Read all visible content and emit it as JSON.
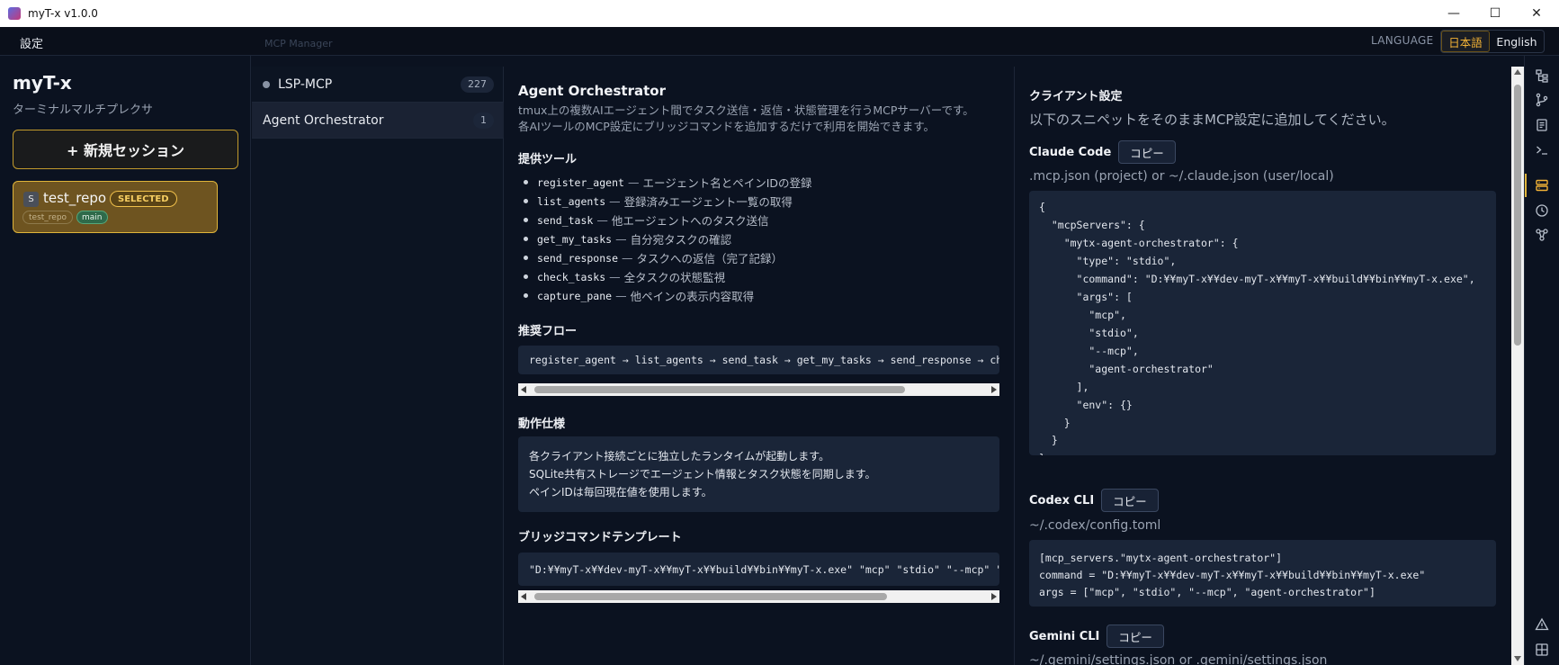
{
  "window": {
    "title": "myT-x v1.0.0",
    "controls": [
      "—",
      "☐",
      "✕"
    ]
  },
  "menubar": {
    "settings": "設定",
    "ghost_text": "MCP Manager",
    "language_label": "LANGUAGE",
    "lang_ja": "日本語",
    "lang_en": "English"
  },
  "sidebar": {
    "app_name": "myT-x",
    "subtitle": "ターミナルマルチプレクサ",
    "new_session": "+ 新規セッション",
    "session": {
      "badge": "S",
      "name": "test_repo",
      "status": "SELECTED",
      "repo_tag": "test_repo",
      "branch_tag": "main"
    }
  },
  "mcp_list": [
    {
      "label": "LSP-MCP",
      "count": "227"
    },
    {
      "label": "Agent Orchestrator",
      "count": "1"
    }
  ],
  "detail": {
    "title": "Agent Orchestrator",
    "desc_1": "tmux上の複数AIエージェント間でタスク送信・返信・状態管理を行うMCPサーバーです。",
    "desc_2": "各AIツールのMCP設定にブリッジコマンドを追加するだけで利用を開始できます。",
    "tools_heading": "提供ツール",
    "tools": [
      {
        "name": "register_agent",
        "sep": "—",
        "desc": "エージェント名とペインIDの登録"
      },
      {
        "name": "list_agents",
        "sep": "—",
        "desc": "登録済みエージェント一覧の取得"
      },
      {
        "name": "send_task",
        "sep": "—",
        "desc": "他エージェントへのタスク送信"
      },
      {
        "name": "get_my_tasks",
        "sep": "—",
        "desc": "自分宛タスクの確認"
      },
      {
        "name": "send_response",
        "sep": "—",
        "desc": "タスクへの返信（完了記録）"
      },
      {
        "name": "check_tasks",
        "sep": "—",
        "desc": "全タスクの状態監視"
      },
      {
        "name": "capture_pane",
        "sep": "—",
        "desc": "他ペインの表示内容取得"
      }
    ],
    "flow_heading": "推奨フロー",
    "flow": "register_agent → list_agents → send_task → get_my_tasks → send_response → check_tasks",
    "spec_heading": "動作仕様",
    "spec_lines": [
      "各クライアント接続ごとに独立したランタイムが起動します。",
      "SQLite共有ストレージでエージェント情報とタスク状態を同期します。",
      "ペインIDは毎回現在値を使用します。"
    ],
    "bridge_heading": "ブリッジコマンドテンプレート",
    "bridge": "\"D:¥¥myT-x¥¥dev-myT-x¥¥myT-x¥¥build¥¥bin¥¥myT-x.exe\" \"mcp\" \"stdio\" \"--mcp\" \"agent-orchestrator\""
  },
  "client": {
    "heading": "クライアント設定",
    "intro": "以下のスニペットをそのままMCP設定に追加してください。",
    "copy_label": "コピー",
    "claude": {
      "name": "Claude Code",
      "path": ".mcp.json (project) or ~/.claude.json (user/local)",
      "lines": [
        "{",
        "  \"mcpServers\": {",
        "    \"mytx-agent-orchestrator\": {",
        "      \"type\": \"stdio\",",
        "      \"command\": \"D:¥¥myT-x¥¥dev-myT-x¥¥myT-x¥¥build¥¥bin¥¥myT-x.exe\",",
        "      \"args\": [",
        "        \"mcp\",",
        "        \"stdio\",",
        "        \"--mcp\",",
        "        \"agent-orchestrator\"",
        "      ],",
        "      \"env\": {}",
        "    }",
        "  }",
        "}"
      ]
    },
    "codex": {
      "name": "Codex CLI",
      "path": "~/.codex/config.toml",
      "lines": [
        "[mcp_servers.\"mytx-agent-orchestrator\"]",
        "command = \"D:¥¥myT-x¥¥dev-myT-x¥¥myT-x¥¥build¥¥bin¥¥myT-x.exe\"",
        "args = [\"mcp\", \"stdio\", \"--mcp\", \"agent-orchestrator\"]"
      ]
    },
    "gemini": {
      "name": "Gemini CLI",
      "path": "~/.gemini/settings.json or .gemini/settings.json"
    }
  },
  "rail_icons": [
    "tree-icon",
    "git-branch-icon",
    "document-icon",
    "terminal-icon",
    "mcp-icon",
    "history-icon",
    "network-icon",
    "warning-icon",
    "layout-icon"
  ]
}
